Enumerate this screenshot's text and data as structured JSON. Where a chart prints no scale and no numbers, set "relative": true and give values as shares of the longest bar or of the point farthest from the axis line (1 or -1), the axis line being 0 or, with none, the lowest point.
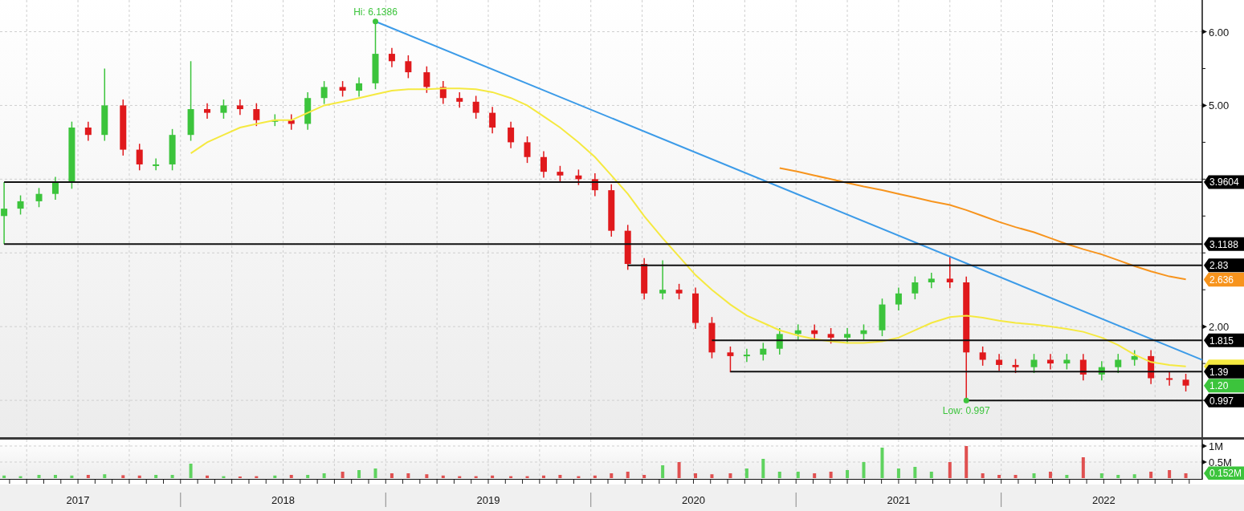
{
  "price_chart": {
    "chart_data": {
      "type": "candlestick",
      "x": [
        2017.14,
        2017.22,
        2017.31,
        2017.39,
        2017.47,
        2017.55,
        2017.63,
        2017.72,
        2017.8,
        2017.88,
        2017.96,
        2018.05,
        2018.13,
        2018.21,
        2018.29,
        2018.37,
        2018.46,
        2018.54,
        2018.62,
        2018.7,
        2018.79,
        2018.87,
        2018.95,
        2019.03,
        2019.11,
        2019.2,
        2019.28,
        2019.36,
        2019.44,
        2019.52,
        2019.61,
        2019.69,
        2019.77,
        2019.85,
        2019.94,
        2020.02,
        2020.1,
        2020.18,
        2020.26,
        2020.35,
        2020.43,
        2020.51,
        2020.59,
        2020.68,
        2020.76,
        2020.84,
        2020.92,
        2021.01,
        2021.09,
        2021.17,
        2021.25,
        2021.33,
        2021.42,
        2021.5,
        2021.58,
        2021.66,
        2021.75,
        2021.83,
        2021.91,
        2021.99,
        2022.07,
        2022.16,
        2022.24,
        2022.32,
        2022.4,
        2022.49,
        2022.57,
        2022.65,
        2022.73,
        2022.82,
        2022.9
      ],
      "ohlc": [
        [
          3.5,
          3.96,
          3.12,
          3.6
        ],
        [
          3.6,
          3.78,
          3.52,
          3.7
        ],
        [
          3.7,
          3.88,
          3.62,
          3.8
        ],
        [
          3.8,
          4.03,
          3.72,
          3.95
        ],
        [
          3.95,
          4.78,
          3.87,
          4.7
        ],
        [
          4.7,
          4.78,
          4.52,
          4.6
        ],
        [
          4.6,
          5.5,
          4.52,
          5.0
        ],
        [
          5.0,
          5.08,
          4.32,
          4.4
        ],
        [
          4.4,
          4.48,
          4.12,
          4.2
        ],
        [
          4.2,
          4.28,
          4.12,
          4.2
        ],
        [
          4.2,
          4.68,
          4.12,
          4.6
        ],
        [
          4.6,
          5.6,
          4.52,
          4.95
        ],
        [
          4.95,
          5.03,
          4.82,
          4.9
        ],
        [
          4.9,
          5.08,
          4.82,
          5.0
        ],
        [
          5.0,
          5.08,
          4.87,
          4.95
        ],
        [
          4.95,
          5.03,
          4.72,
          4.8
        ],
        [
          4.8,
          4.88,
          4.72,
          4.8
        ],
        [
          4.8,
          4.88,
          4.67,
          4.75
        ],
        [
          4.75,
          5.18,
          4.67,
          5.1
        ],
        [
          5.1,
          5.33,
          5.02,
          5.25
        ],
        [
          5.25,
          5.33,
          5.12,
          5.2
        ],
        [
          5.2,
          5.38,
          5.12,
          5.3
        ],
        [
          5.3,
          6.1386,
          5.22,
          5.7
        ],
        [
          5.7,
          5.78,
          5.52,
          5.6
        ],
        [
          5.6,
          5.68,
          5.37,
          5.45
        ],
        [
          5.45,
          5.53,
          5.17,
          5.25
        ],
        [
          5.25,
          5.33,
          5.02,
          5.1
        ],
        [
          5.1,
          5.18,
          4.97,
          5.05
        ],
        [
          5.05,
          5.13,
          4.82,
          4.9
        ],
        [
          4.9,
          4.98,
          4.62,
          4.7
        ],
        [
          4.7,
          4.78,
          4.42,
          4.5
        ],
        [
          4.5,
          4.58,
          4.22,
          4.3
        ],
        [
          4.3,
          4.38,
          4.02,
          4.1
        ],
        [
          4.1,
          4.18,
          3.97,
          4.05
        ],
        [
          4.05,
          4.13,
          3.92,
          4.0
        ],
        [
          4.0,
          4.08,
          3.77,
          3.85
        ],
        [
          3.85,
          3.93,
          3.22,
          3.3
        ],
        [
          3.3,
          3.38,
          2.77,
          2.85
        ],
        [
          2.85,
          2.93,
          2.37,
          2.45
        ],
        [
          2.45,
          2.9,
          2.37,
          2.5
        ],
        [
          2.5,
          2.58,
          2.37,
          2.45
        ],
        [
          2.45,
          2.53,
          1.97,
          2.05
        ],
        [
          2.05,
          2.13,
          1.57,
          1.65
        ],
        [
          1.65,
          1.73,
          1.38,
          1.6
        ],
        [
          1.6,
          1.7,
          1.52,
          1.62
        ],
        [
          1.62,
          1.78,
          1.54,
          1.7
        ],
        [
          1.7,
          1.98,
          1.62,
          1.9
        ],
        [
          1.9,
          2.03,
          1.82,
          1.95
        ],
        [
          1.95,
          2.03,
          1.82,
          1.9
        ],
        [
          1.9,
          1.98,
          1.77,
          1.85
        ],
        [
          1.85,
          1.98,
          1.77,
          1.9
        ],
        [
          1.9,
          2.03,
          1.82,
          1.95
        ],
        [
          1.95,
          2.38,
          1.87,
          2.3
        ],
        [
          2.3,
          2.53,
          2.22,
          2.45
        ],
        [
          2.45,
          2.68,
          2.37,
          2.6
        ],
        [
          2.6,
          2.73,
          2.52,
          2.65
        ],
        [
          2.65,
          2.95,
          2.52,
          2.6
        ],
        [
          2.6,
          2.68,
          0.997,
          1.65
        ],
        [
          1.65,
          1.73,
          1.47,
          1.55
        ],
        [
          1.55,
          1.63,
          1.4,
          1.48
        ],
        [
          1.48,
          1.56,
          1.37,
          1.45
        ],
        [
          1.45,
          1.63,
          1.37,
          1.55
        ],
        [
          1.55,
          1.63,
          1.42,
          1.5
        ],
        [
          1.5,
          1.63,
          1.42,
          1.55
        ],
        [
          1.55,
          1.63,
          1.27,
          1.35
        ],
        [
          1.35,
          1.53,
          1.27,
          1.45
        ],
        [
          1.45,
          1.63,
          1.37,
          1.55
        ],
        [
          1.55,
          1.68,
          1.47,
          1.6
        ],
        [
          1.6,
          1.68,
          1.22,
          1.3
        ],
        [
          1.3,
          1.38,
          1.2,
          1.28
        ],
        [
          1.28,
          1.36,
          1.12,
          1.2
        ]
      ],
      "xlim": [
        2017.12,
        2022.98
      ],
      "ylim": [
        0.5,
        6.43
      ],
      "grid": true,
      "yticks": [
        {
          "value": 2,
          "label": "2.00"
        },
        {
          "value": 5,
          "label": "5.00"
        },
        {
          "value": 6,
          "label": "6.00"
        }
      ],
      "xticks": [
        {
          "value": 2017.5,
          "label": "2017"
        },
        {
          "value": 2018.5,
          "label": "2018"
        },
        {
          "value": 2019.5,
          "label": "2019"
        },
        {
          "value": 2020.5,
          "label": "2020"
        },
        {
          "value": 2021.5,
          "label": "2021"
        },
        {
          "value": 2022.5,
          "label": "2022"
        }
      ],
      "ref_lines": [
        {
          "axis": "y",
          "value": 3.9604,
          "label": "3.9604"
        },
        {
          "axis": "y",
          "value": 3.1188,
          "label": "3.1188"
        },
        {
          "axis": "y",
          "value": 2.83,
          "label": "2.83"
        },
        {
          "axis": "y",
          "value": 1.815,
          "label": "1.815"
        },
        {
          "axis": "y",
          "value": 1.39,
          "label": "1.39"
        },
        {
          "axis": "y",
          "value": 0.997,
          "label": "0.997"
        }
      ],
      "annotations": [
        {
          "text": "Hi: 6.1386",
          "x": 2018.95,
          "y": 6.1386
        },
        {
          "text": "Low: 0.997",
          "x": 2021.83,
          "y": 0.997
        },
        "2.636",
        "1.20"
      ]
    },
    "moving_averages": {
      "chart_data": {
        "type": "line",
        "x": [
          2018.05,
          2018.13,
          2018.21,
          2018.29,
          2018.37,
          2018.46,
          2018.54,
          2018.62,
          2018.7,
          2018.79,
          2018.87,
          2018.95,
          2019.03,
          2019.11,
          2019.2,
          2019.28,
          2019.36,
          2019.44,
          2019.52,
          2019.61,
          2019.69,
          2019.77,
          2019.85,
          2019.94,
          2020.02,
          2020.1,
          2020.18,
          2020.26,
          2020.35,
          2020.43,
          2020.51,
          2020.59,
          2020.68,
          2020.76,
          2020.84,
          2020.92,
          2021.01,
          2021.09,
          2021.17,
          2021.25,
          2021.33,
          2021.42,
          2021.5,
          2021.58,
          2021.66,
          2021.75,
          2021.83,
          2021.91,
          2021.99,
          2022.07,
          2022.16,
          2022.24,
          2022.32,
          2022.4,
          2022.49,
          2022.57,
          2022.65,
          2022.73,
          2022.82,
          2022.9
        ],
        "series": [
          {
            "color": "#f5e940",
            "values": [
              4.35,
              4.5,
              4.6,
              4.7,
              4.75,
              4.8,
              4.8,
              4.9,
              5.0,
              5.05,
              5.1,
              5.15,
              5.2,
              5.22,
              5.22,
              5.23,
              5.23,
              5.22,
              5.18,
              5.1,
              5.0,
              4.85,
              4.7,
              4.5,
              4.3,
              4.05,
              3.8,
              3.5,
              3.2,
              2.95,
              2.7,
              2.5,
              2.3,
              2.15,
              2.05,
              1.95,
              1.88,
              1.83,
              1.8,
              1.78,
              1.78,
              1.8,
              1.85,
              1.95,
              2.05,
              2.13,
              2.15,
              2.12,
              2.08,
              2.05,
              2.03,
              2.0,
              1.97,
              1.93,
              1.85,
              1.75,
              1.62,
              1.52,
              1.48,
              1.46
            ]
          },
          {
            "color": "#f7941d",
            "values": [
              null,
              null,
              null,
              null,
              null,
              null,
              null,
              null,
              null,
              null,
              null,
              null,
              null,
              null,
              null,
              null,
              null,
              null,
              null,
              null,
              null,
              null,
              null,
              null,
              null,
              null,
              null,
              null,
              null,
              null,
              null,
              null,
              null,
              null,
              null,
              4.15,
              4.1,
              4.05,
              4.0,
              3.95,
              3.9,
              3.85,
              3.8,
              3.75,
              3.7,
              3.65,
              3.58,
              3.5,
              3.42,
              3.35,
              3.28,
              3.2,
              3.12,
              3.05,
              2.98,
              2.9,
              2.82,
              2.75,
              2.68,
              2.64
            ]
          }
        ],
        "xlim": [
          2017.12,
          2022.98
        ],
        "ylim": [
          0.5,
          6.43
        ],
        "relative": true
      }
    }
  },
  "volume_chart": {
    "chart_data": {
      "type": "bar",
      "stacked": true,
      "x": [
        2017.14,
        2017.22,
        2017.31,
        2017.39,
        2017.47,
        2017.55,
        2017.63,
        2017.72,
        2017.8,
        2017.88,
        2017.96,
        2018.05,
        2018.13,
        2018.21,
        2018.29,
        2018.37,
        2018.46,
        2018.54,
        2018.62,
        2018.7,
        2018.79,
        2018.87,
        2018.95,
        2019.03,
        2019.11,
        2019.2,
        2019.28,
        2019.36,
        2019.44,
        2019.52,
        2019.61,
        2019.69,
        2019.77,
        2019.85,
        2019.94,
        2020.02,
        2020.1,
        2020.18,
        2020.26,
        2020.35,
        2020.43,
        2020.51,
        2020.59,
        2020.68,
        2020.76,
        2020.84,
        2020.92,
        2021.01,
        2021.09,
        2021.17,
        2021.25,
        2021.33,
        2021.42,
        2021.5,
        2021.58,
        2021.66,
        2021.75,
        2021.83,
        2021.91,
        2021.99,
        2022.07,
        2022.16,
        2022.24,
        2022.32,
        2022.4,
        2022.49,
        2022.57,
        2022.65,
        2022.73,
        2022.82,
        2022.9
      ],
      "series": [
        {
          "color": "#5fd35f",
          "values": [
            0.08,
            0.06,
            0.1,
            0.1,
            0.08,
            null,
            0.12,
            null,
            null,
            0.1,
            0.1,
            0.45,
            null,
            0.06,
            null,
            null,
            0.08,
            null,
            0.1,
            0.15,
            null,
            0.25,
            0.3,
            null,
            null,
            null,
            null,
            null,
            null,
            null,
            null,
            null,
            null,
            null,
            null,
            null,
            null,
            null,
            null,
            0.4,
            null,
            null,
            null,
            null,
            0.3,
            0.6,
            0.2,
            0.2,
            null,
            null,
            0.25,
            0.5,
            0.95,
            0.3,
            0.35,
            0.2,
            null,
            null,
            null,
            null,
            null,
            0.15,
            null,
            0.1,
            null,
            0.15,
            0.1,
            0.12,
            null,
            null,
            null
          ]
        },
        {
          "color": "#e05050",
          "values": [
            null,
            null,
            null,
            null,
            null,
            0.1,
            null,
            0.09,
            0.08,
            null,
            null,
            null,
            0.08,
            null,
            0.05,
            0.06,
            null,
            0.1,
            null,
            null,
            0.2,
            null,
            null,
            0.15,
            0.15,
            0.12,
            0.08,
            0.06,
            0.06,
            0.08,
            0.06,
            0.06,
            0.08,
            0.1,
            0.06,
            0.08,
            0.15,
            0.2,
            0.1,
            null,
            0.5,
            0.15,
            0.12,
            0.15,
            null,
            null,
            null,
            null,
            0.15,
            0.2,
            null,
            null,
            null,
            null,
            null,
            null,
            0.5,
            1.0,
            0.15,
            0.1,
            0.1,
            null,
            0.2,
            null,
            0.65,
            null,
            null,
            null,
            0.2,
            0.25,
            0.15
          ]
        }
      ],
      "xlim": [
        2017.12,
        2022.98
      ],
      "ylim": [
        0,
        1.2
      ],
      "grid": true,
      "yticks": [
        {
          "value": 1,
          "label": "1M"
        },
        {
          "value": 0.5,
          "label": "0.5M"
        }
      ],
      "annotations": [
        "0.152M"
      ]
    }
  }
}
